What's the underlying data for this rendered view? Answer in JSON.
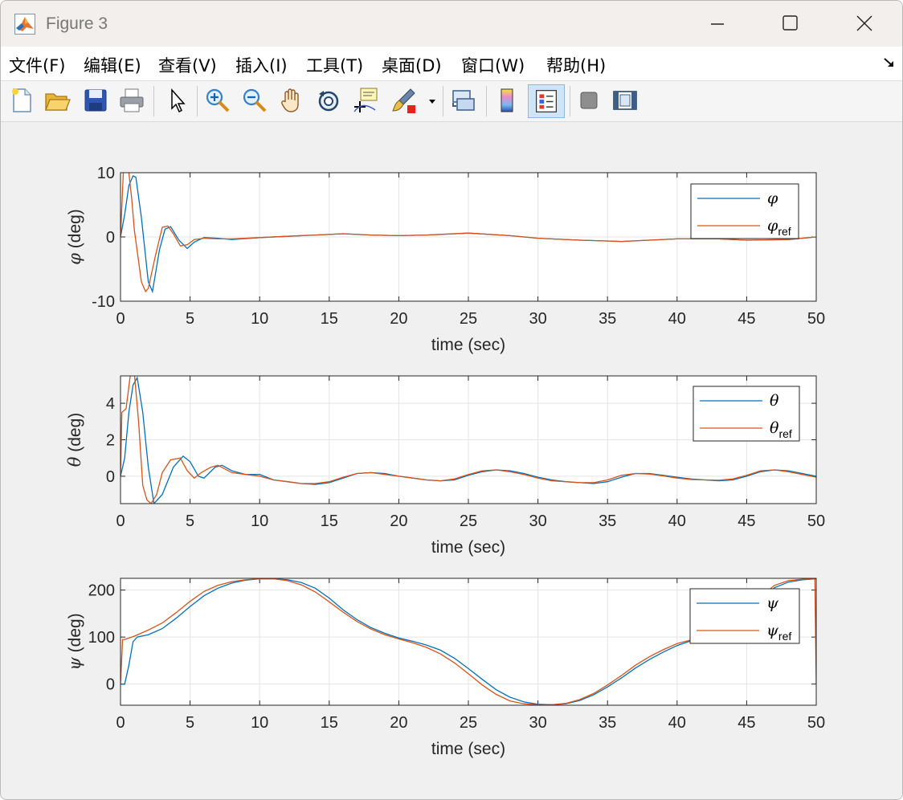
{
  "window": {
    "title": "Figure 3"
  },
  "menu": [
    "文件(F)",
    "编辑(E)",
    "查看(V)",
    "插入(I)",
    "工具(T)",
    "桌面(D)",
    "窗口(W)",
    "帮助(H)"
  ],
  "toolbar": [
    "new-figure-icon",
    "open-file-icon",
    "save-icon",
    "print-icon",
    "edit-plot-arrow-icon",
    "zoom-in-icon",
    "zoom-out-icon",
    "pan-hand-icon",
    "rotate-3d-icon",
    "data-cursor-icon",
    "brush-icon",
    "link-plot-icon",
    "colorbar-icon",
    "legend-icon",
    "hide-plot-tools-icon",
    "show-plot-tools-icon"
  ],
  "colors": {
    "measured": "#0072BD",
    "reference": "#D95319"
  },
  "chart_data": [
    {
      "type": "line",
      "ylabel_symbol": "φ",
      "ylabel_unit": " (deg)",
      "xlabel": "time (sec)",
      "xlim": [
        0,
        50
      ],
      "ylim": [
        -10,
        10
      ],
      "xticks": [
        "0",
        "5",
        "10",
        "15",
        "20",
        "25",
        "30",
        "35",
        "40",
        "45",
        "50"
      ],
      "yticks": [
        {
          "v": 10,
          "l": "10"
        },
        {
          "v": 0,
          "l": "0"
        },
        {
          "v": -10,
          "l": "-10"
        }
      ],
      "legend": {
        "position": "top-right",
        "entries": [
          {
            "sym": "φ",
            "sub": ""
          },
          {
            "sym": "φ",
            "sub": "ref"
          }
        ]
      },
      "series": [
        {
          "role": "measured",
          "x": [
            0,
            0.3,
            0.6,
            0.9,
            1.1,
            1.5,
            2.0,
            2.3,
            2.8,
            3.2,
            3.6,
            4.2,
            4.8,
            5.3,
            6.0,
            7.0,
            8.0,
            10,
            12,
            14,
            16,
            18,
            20,
            22,
            25,
            28,
            30,
            33,
            36,
            40,
            43,
            45,
            48,
            50
          ],
          "y": [
            0,
            3.5,
            8,
            9.5,
            9.3,
            3,
            -7,
            -8.5,
            -2,
            1.2,
            1.6,
            -0.5,
            -1.8,
            -0.8,
            -0.1,
            -0.2,
            -0.4,
            -0.1,
            0.1,
            0.3,
            0.5,
            0.3,
            0.2,
            0.3,
            0.6,
            0.2,
            -0.2,
            -0.5,
            -0.7,
            -0.3,
            -0.3,
            -0.5,
            -0.4,
            0
          ]
        },
        {
          "role": "reference",
          "x": [
            0,
            0.2,
            0.4,
            0.6,
            0.8,
            1.0,
            1.5,
            1.8,
            2.0,
            2.5,
            3.0,
            3.4,
            3.8,
            4.3,
            4.8,
            5.3,
            6.0,
            7.0,
            8.0,
            10,
            12,
            14,
            16,
            18,
            20,
            22,
            25,
            28,
            30,
            33,
            36,
            40,
            43,
            45,
            48,
            50
          ],
          "y": [
            0,
            10,
            11,
            10,
            6,
            1,
            -7,
            -8.5,
            -8,
            -3,
            1.5,
            1.7,
            0.5,
            -1.4,
            -1.2,
            -0.4,
            -0.2,
            -0.3,
            -0.3,
            -0.1,
            0.1,
            0.3,
            0.5,
            0.3,
            0.2,
            0.3,
            0.6,
            0.2,
            -0.2,
            -0.5,
            -0.7,
            -0.3,
            -0.3,
            -0.5,
            -0.4,
            0
          ]
        }
      ]
    },
    {
      "type": "line",
      "ylabel_symbol": "θ",
      "ylabel_unit": " (deg)",
      "xlabel": "time (sec)",
      "xlim": [
        0,
        50
      ],
      "ylim": [
        -1.5,
        5.5
      ],
      "xticks": [
        "0",
        "5",
        "10",
        "15",
        "20",
        "25",
        "30",
        "35",
        "40",
        "45",
        "50"
      ],
      "yticks": [
        {
          "v": 4,
          "l": "4"
        },
        {
          "v": 2,
          "l": "2"
        },
        {
          "v": 0,
          "l": "0"
        }
      ],
      "legend": {
        "position": "top-right",
        "entries": [
          {
            "sym": "θ",
            "sub": ""
          },
          {
            "sym": "θ",
            "sub": "ref"
          }
        ]
      },
      "series": [
        {
          "role": "measured",
          "x": [
            0,
            0.3,
            0.6,
            0.9,
            1.2,
            1.6,
            2.0,
            2.4,
            3.0,
            3.8,
            4.5,
            5.0,
            5.6,
            6.0,
            6.8,
            7.3,
            8.0,
            9.0,
            10,
            11,
            12,
            13,
            14,
            15,
            16,
            17,
            18,
            19,
            20,
            21,
            22,
            23,
            24,
            25,
            26,
            27,
            28,
            29,
            30,
            31,
            32,
            33,
            34,
            35,
            36,
            37,
            38,
            39,
            40,
            41,
            42,
            43,
            44,
            45,
            46,
            47,
            48,
            49,
            50
          ],
          "y": [
            0,
            1,
            3.5,
            5,
            5.4,
            3.5,
            0.5,
            -1.5,
            -1.0,
            0.5,
            1.1,
            0.8,
            0,
            -0.1,
            0.5,
            0.6,
            0.3,
            0.1,
            0.1,
            -0.2,
            -0.3,
            -0.4,
            -0.45,
            -0.35,
            -0.1,
            0.15,
            0.2,
            0.15,
            0,
            -0.1,
            -0.2,
            -0.25,
            -0.2,
            0.05,
            0.25,
            0.35,
            0.3,
            0.15,
            -0.05,
            -0.2,
            -0.3,
            -0.35,
            -0.4,
            -0.3,
            -0.05,
            0.15,
            0.15,
            0.05,
            -0.05,
            -0.15,
            -0.2,
            -0.25,
            -0.2,
            0,
            0.25,
            0.35,
            0.3,
            0.15,
            0
          ]
        },
        {
          "role": "reference",
          "x": [
            0,
            0.1,
            0.4,
            0.7,
            1.0,
            1.3,
            1.6,
            1.9,
            2.2,
            2.6,
            3.0,
            3.6,
            4.3,
            4.8,
            5.3,
            5.8,
            6.5,
            7.0,
            7.5,
            8.0,
            9.0,
            10,
            11,
            12,
            13,
            14,
            15,
            16,
            17,
            18,
            19,
            20,
            21,
            22,
            23,
            24,
            25,
            26,
            27,
            28,
            29,
            30,
            31,
            32,
            33,
            34,
            35,
            36,
            37,
            38,
            39,
            40,
            41,
            42,
            43,
            44,
            45,
            46,
            47,
            48,
            49,
            50
          ],
          "y": [
            0,
            3.5,
            3.7,
            5.5,
            5.6,
            3,
            -0.5,
            -1.3,
            -1.5,
            -1.0,
            0.2,
            0.9,
            1.0,
            0.3,
            -0.1,
            0.2,
            0.5,
            0.6,
            0.4,
            0.2,
            0.1,
            0,
            -0.2,
            -0.3,
            -0.4,
            -0.4,
            -0.3,
            -0.05,
            0.15,
            0.2,
            0.1,
            0,
            -0.1,
            -0.2,
            -0.25,
            -0.15,
            0.1,
            0.3,
            0.35,
            0.25,
            0.1,
            -0.1,
            -0.25,
            -0.3,
            -0.35,
            -0.35,
            -0.2,
            0.05,
            0.15,
            0.12,
            0.02,
            -0.1,
            -0.18,
            -0.2,
            -0.22,
            -0.15,
            0.05,
            0.3,
            0.35,
            0.25,
            0.1,
            -0.05
          ]
        }
      ]
    },
    {
      "type": "line",
      "ylabel_symbol": "ψ",
      "ylabel_unit": " (deg)",
      "xlabel": "time (sec)",
      "xlim": [
        0,
        50
      ],
      "ylim": [
        -45,
        225
      ],
      "xticks": [
        "0",
        "5",
        "10",
        "15",
        "20",
        "25",
        "30",
        "35",
        "40",
        "45",
        "50"
      ],
      "yticks": [
        {
          "v": 200,
          "l": "200"
        },
        {
          "v": 100,
          "l": "100"
        },
        {
          "v": 0,
          "l": "0"
        }
      ],
      "legend": {
        "position": "top-right",
        "entries": [
          {
            "sym": "ψ",
            "sub": ""
          },
          {
            "sym": "ψ",
            "sub": "ref"
          }
        ]
      },
      "series": [
        {
          "role": "measured",
          "x": [
            0,
            0.3,
            0.6,
            0.9,
            1.2,
            2.0,
            3.0,
            4.0,
            5.0,
            6.0,
            7.0,
            8.0,
            9.0,
            10,
            11,
            12,
            13,
            14,
            15,
            16,
            17,
            18,
            19,
            20,
            21,
            22,
            23,
            24,
            25,
            26,
            27,
            28,
            29,
            30,
            31,
            32,
            33,
            34,
            35,
            36,
            37,
            38,
            39,
            40,
            41,
            42,
            43,
            44,
            45,
            46,
            47,
            48,
            49,
            50
          ],
          "y": [
            0,
            0,
            40,
            90,
            100,
            105,
            118,
            140,
            165,
            188,
            204,
            215,
            221,
            224,
            224,
            222,
            216,
            204,
            183,
            158,
            137,
            120,
            108,
            98,
            91,
            83,
            72,
            55,
            33,
            10,
            -12,
            -28,
            -38,
            -43,
            -44,
            -42,
            -35,
            -23,
            -6,
            13,
            34,
            52,
            68,
            82,
            92,
            98,
            106,
            120,
            147,
            180,
            205,
            217,
            222,
            224
          ]
        },
        {
          "role": "reference",
          "x": [
            0,
            0.15,
            0.3,
            1.0,
            2.0,
            3.0,
            4.0,
            5.0,
            6.0,
            7.0,
            8.0,
            9.0,
            10,
            11,
            12,
            13,
            14,
            15,
            16,
            17,
            18,
            19,
            20,
            21,
            22,
            23,
            24,
            25,
            26,
            27,
            28,
            29,
            30,
            31,
            32,
            33,
            34,
            35,
            36,
            37,
            38,
            39,
            40,
            41,
            42,
            43,
            44,
            45,
            46,
            47,
            48,
            49,
            49.9,
            50
          ],
          "y": [
            0,
            95,
            95,
            102,
            115,
            130,
            152,
            176,
            197,
            210,
            218,
            222,
            224,
            224,
            220,
            211,
            196,
            175,
            153,
            133,
            117,
            105,
            96,
            88,
            78,
            64,
            45,
            22,
            -2,
            -22,
            -36,
            -42,
            -44,
            -44,
            -41,
            -33,
            -20,
            -2,
            18,
            40,
            58,
            73,
            86,
            94,
            101,
            108,
            123,
            152,
            186,
            210,
            220,
            223,
            224,
            0
          ]
        }
      ]
    }
  ]
}
